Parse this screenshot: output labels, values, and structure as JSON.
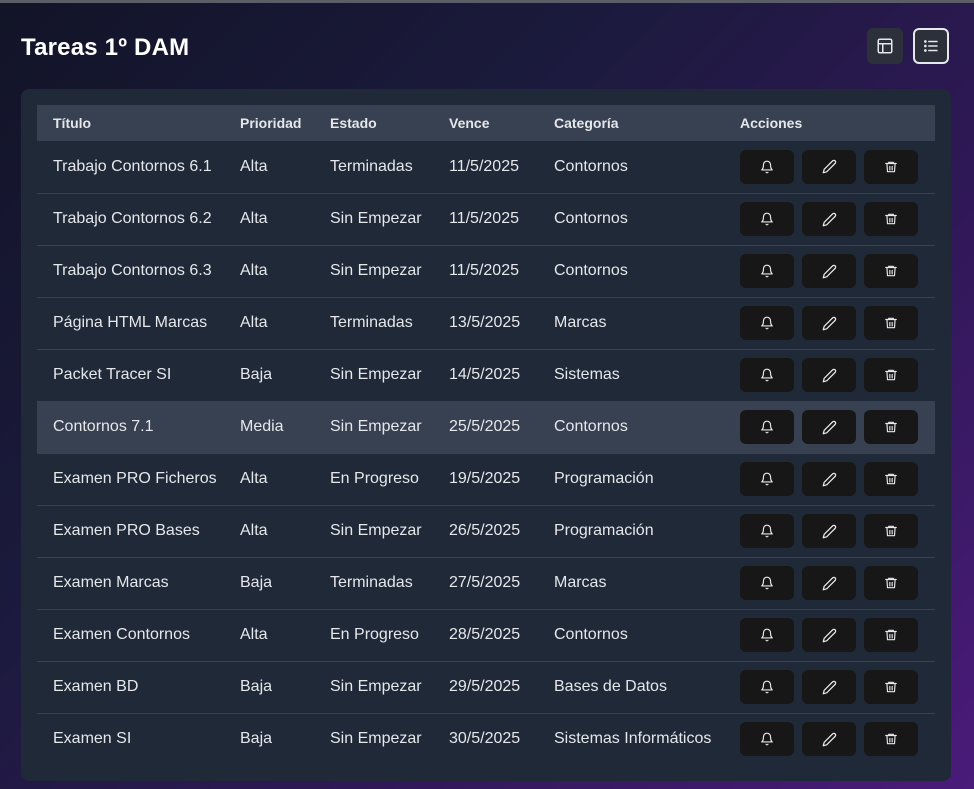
{
  "page": {
    "title": "Tareas 1º DAM"
  },
  "view_toggle": {
    "grid_icon": "layout-icon",
    "list_icon": "list-icon",
    "active": "list"
  },
  "table": {
    "headers": [
      "Título",
      "Prioridad",
      "Estado",
      "Vence",
      "Categoría",
      "Acciones"
    ],
    "rows": [
      {
        "titulo": "Trabajo Contornos 6.1",
        "prioridad": "Alta",
        "estado": "Terminadas",
        "vence": "11/5/2025",
        "categoria": "Contornos"
      },
      {
        "titulo": "Trabajo Contornos 6.2",
        "prioridad": "Alta",
        "estado": "Sin Empezar",
        "vence": "11/5/2025",
        "categoria": "Contornos"
      },
      {
        "titulo": "Trabajo Contornos 6.3",
        "prioridad": "Alta",
        "estado": "Sin Empezar",
        "vence": "11/5/2025",
        "categoria": "Contornos"
      },
      {
        "titulo": "Página HTML Marcas",
        "prioridad": "Alta",
        "estado": "Terminadas",
        "vence": "13/5/2025",
        "categoria": "Marcas"
      },
      {
        "titulo": "Packet Tracer SI",
        "prioridad": "Baja",
        "estado": "Sin Empezar",
        "vence": "14/5/2025",
        "categoria": "Sistemas"
      },
      {
        "titulo": "Contornos 7.1",
        "prioridad": "Media",
        "estado": "Sin Empezar",
        "vence": "25/5/2025",
        "categoria": "Contornos"
      },
      {
        "titulo": "Examen PRO Ficheros",
        "prioridad": "Alta",
        "estado": "En Progreso",
        "vence": "19/5/2025",
        "categoria": "Programación"
      },
      {
        "titulo": "Examen PRO Bases",
        "prioridad": "Alta",
        "estado": "Sin Empezar",
        "vence": "26/5/2025",
        "categoria": "Programación"
      },
      {
        "titulo": "Examen Marcas",
        "prioridad": "Baja",
        "estado": "Terminadas",
        "vence": "27/5/2025",
        "categoria": "Marcas"
      },
      {
        "titulo": "Examen Contornos",
        "prioridad": "Alta",
        "estado": "En Progreso",
        "vence": "28/5/2025",
        "categoria": "Contornos"
      },
      {
        "titulo": "Examen BD",
        "prioridad": "Baja",
        "estado": "Sin Empezar",
        "vence": "29/5/2025",
        "categoria": "Bases de Datos"
      },
      {
        "titulo": "Examen SI",
        "prioridad": "Baja",
        "estado": "Sin Empezar",
        "vence": "30/5/2025",
        "categoria": "Sistemas Informáticos"
      }
    ],
    "highlighted_row": 5,
    "row_actions": [
      "bell-icon",
      "pencil-icon",
      "trash-icon"
    ]
  },
  "colors": {
    "card_bg": "#1f2937",
    "header_bg": "#374151",
    "action_btn_bg": "#171717",
    "text": "#e5e7eb"
  }
}
